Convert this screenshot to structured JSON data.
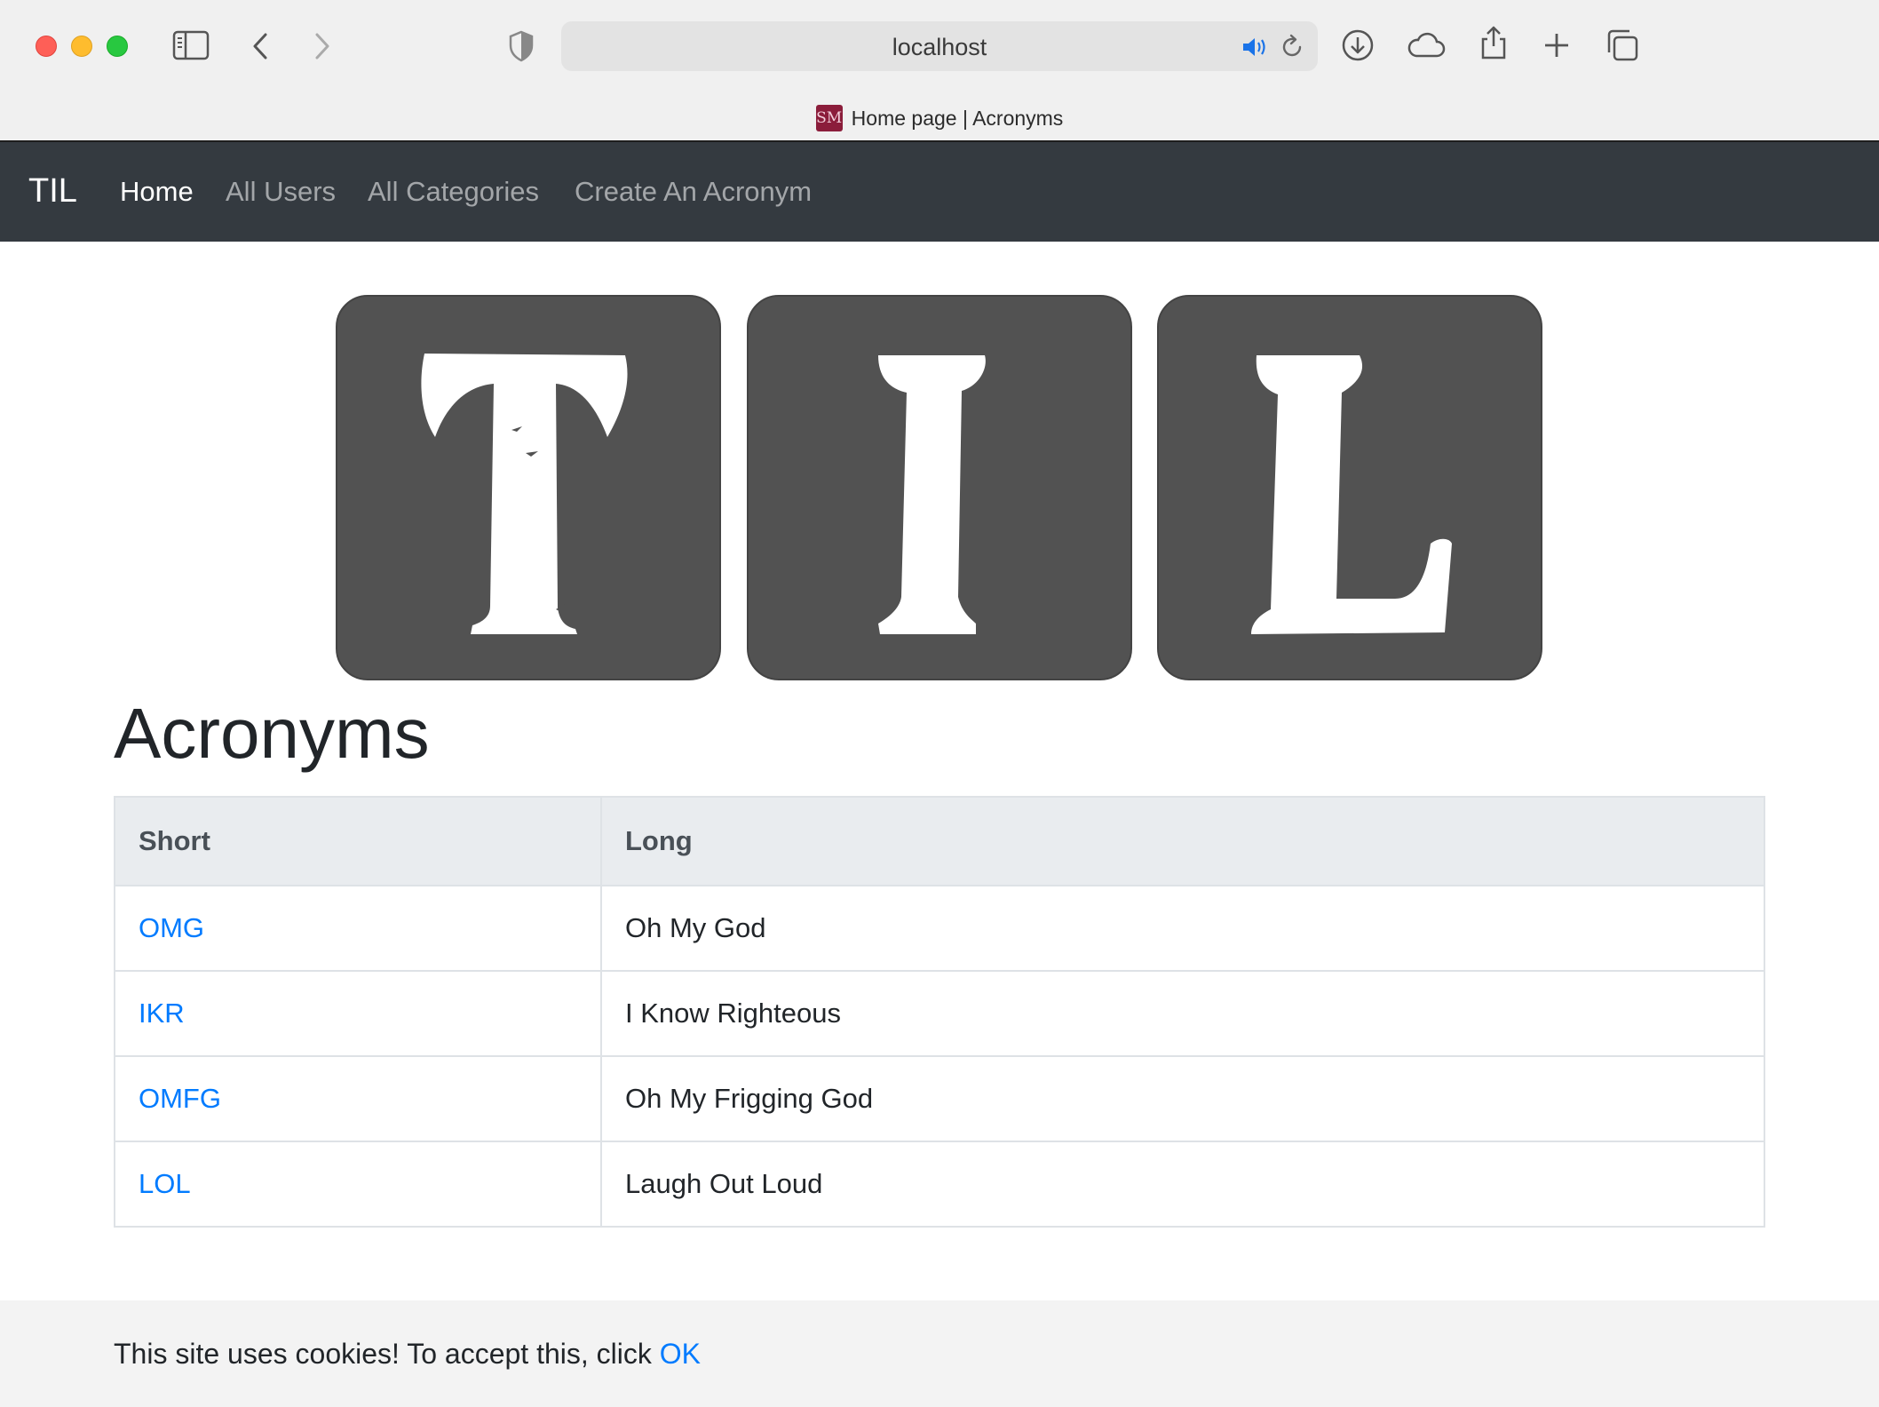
{
  "browser": {
    "url": "localhost",
    "tab_title": "Home page | Acronyms",
    "favicon_text": "SM"
  },
  "navbar": {
    "brand": "TIL",
    "links": [
      {
        "label": "Home",
        "active": true
      },
      {
        "label": "All Users",
        "active": false
      },
      {
        "label": "All Categories",
        "active": false
      },
      {
        "label": "Create An Acronym",
        "active": false
      }
    ]
  },
  "logo": {
    "letters": [
      "T",
      "I",
      "L"
    ],
    "tile_color": "#525252"
  },
  "main": {
    "heading": "Acronyms",
    "table": {
      "headers": [
        "Short",
        "Long"
      ],
      "rows": [
        {
          "short": "OMG",
          "long": "Oh My God"
        },
        {
          "short": "IKR",
          "long": "I Know Righteous"
        },
        {
          "short": "OMFG",
          "long": "Oh My Frigging God"
        },
        {
          "short": "LOL",
          "long": "Laugh Out Loud"
        }
      ]
    }
  },
  "cookie": {
    "message": "This site uses cookies! To accept this, click ",
    "ok_label": "OK"
  },
  "colors": {
    "navbar_bg": "#343a40",
    "link": "#007bff",
    "table_header_bg": "#e9ecef"
  }
}
